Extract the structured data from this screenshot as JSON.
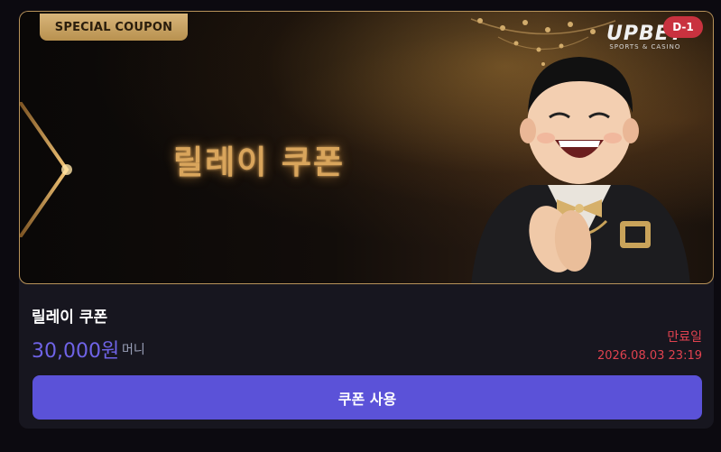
{
  "banner": {
    "badge": "SPECIAL COUPON",
    "title": "릴레이 쿠폰",
    "logo_main": "UPBET",
    "logo_sub": "SPORTS & CASINO",
    "dday": "D-1"
  },
  "coupon": {
    "name": "릴레이 쿠폰",
    "amount": "30,000원",
    "unit": "머니",
    "expiry_label": "만료일",
    "expiry_date": "2026.08.03 23:19",
    "use_button": "쿠폰 사용"
  },
  "colors": {
    "accent": "#5b52d8",
    "amount": "#6f63e6",
    "expiry": "#e0424f",
    "gold": "#d8b57a",
    "dday": "#c9323f"
  },
  "icons": [
    "chevron-right-icon",
    "chandelier-image",
    "mascot-image"
  ]
}
